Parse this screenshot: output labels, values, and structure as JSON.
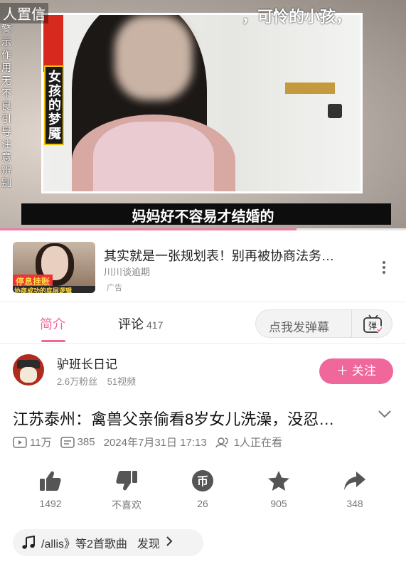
{
  "video": {
    "top_left_tag": "人置信",
    "top_caption": "，可怜的小孩，",
    "warning_vertical": "警示作用无不良引导注意辨别",
    "side_caption": "女孩的梦魇",
    "subtitle": "妈妈好不容易才结婚的",
    "progress_fraction": 0.73
  },
  "ad": {
    "thumb_ribbon_top": "停息挂账",
    "thumb_ribbon_bottom": "协商成功的底层逻辑",
    "title": "其实就是一张规划表！别再被协商法务…",
    "author": "川川谈逾期",
    "label": "广告",
    "more_icon": "more-vertical-icon"
  },
  "tabs": {
    "intro": "简介",
    "comments": "评论",
    "comments_count": "417",
    "danmu_placeholder": "点我发弹幕",
    "danmu_button_icon": "danmu-toggle-icon",
    "accent_color": "#f0689b"
  },
  "uploader": {
    "name": "驴班长日记",
    "fans": "2.6万粉丝",
    "videos": "51视频",
    "follow_label": "＋ 关注"
  },
  "video_info": {
    "title": "江苏泰州：禽兽父亲偷看8岁女儿洗澡，没忍…",
    "plays": "11万",
    "danmaku": "385",
    "datetime": "2024年7月31日 17:13",
    "watching": "1人正在看"
  },
  "actions": {
    "like": "1492",
    "dislike": "不喜欢",
    "coin": "26",
    "favorite": "905",
    "share": "348"
  },
  "music": {
    "song": "/allis》等2首歌曲",
    "discover": "发现"
  }
}
